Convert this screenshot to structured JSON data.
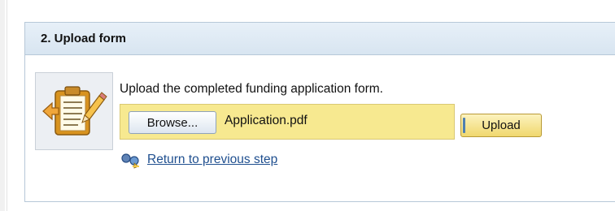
{
  "panel": {
    "title": "2. Upload form"
  },
  "form": {
    "instruction": "Upload the completed funding application form.",
    "browse_label": "Browse...",
    "file_name": "Application.pdf",
    "upload_label": "Upload"
  },
  "navigation": {
    "back_link": "Return to previous step"
  },
  "icons": {
    "clipboard": "clipboard-edit-icon",
    "back": "return-arrow-icon"
  },
  "colors": {
    "header_bg": "#dfeaf5",
    "file_row_bg": "#f7e990",
    "link": "#1f4f8f"
  }
}
